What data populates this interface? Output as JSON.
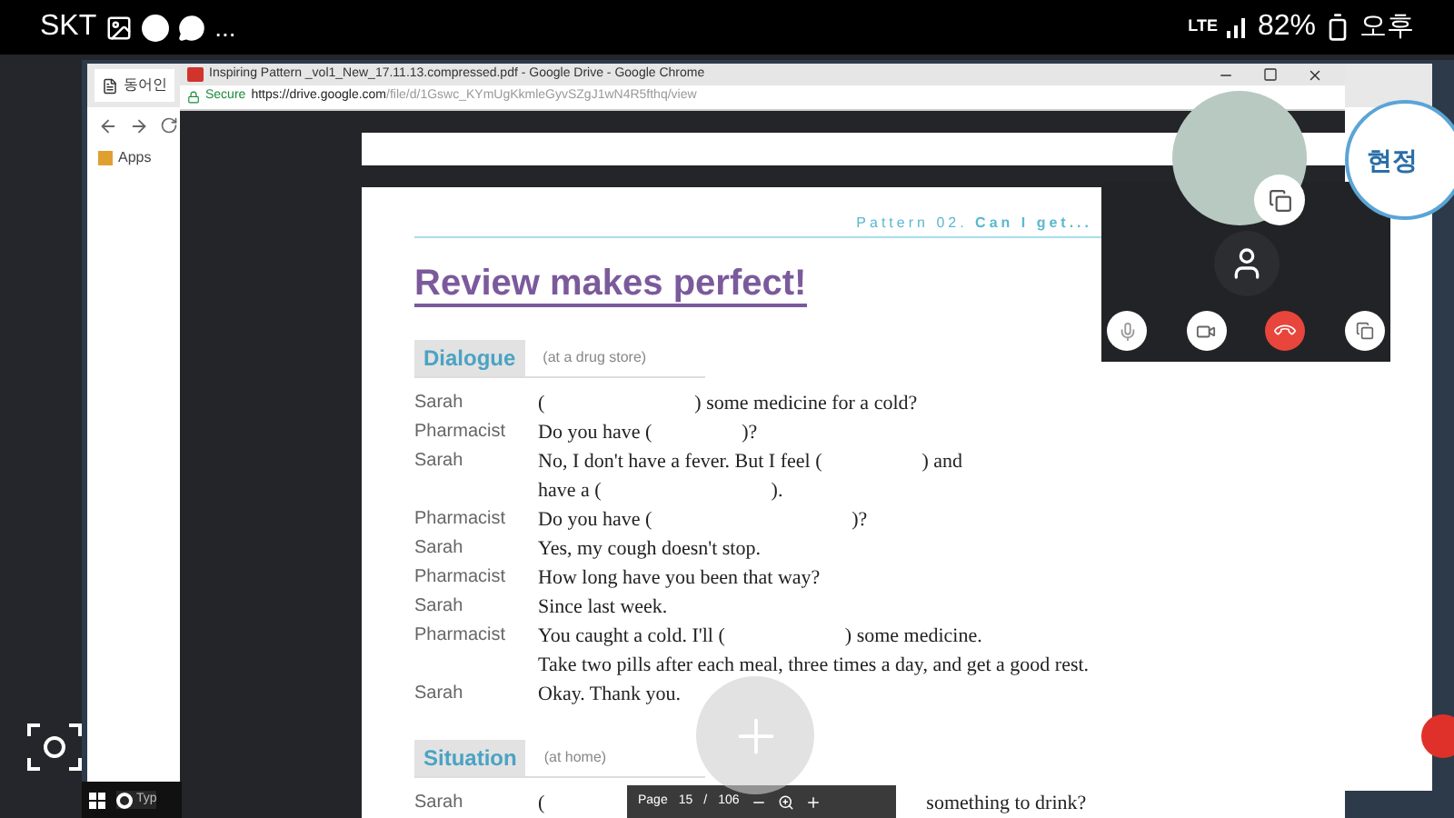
{
  "status_bar": {
    "carrier": "SKT",
    "more": "...",
    "network": "LTE",
    "battery": "82%",
    "time": "오후"
  },
  "back_window": {
    "tab": "동어인",
    "bookmark": "Apps"
  },
  "window": {
    "title": "Inspiring Pattern _vol1_New_17.11.13.compressed.pdf - Google Drive - Google Chrome",
    "secure": "Secure",
    "url_host": "https://drive.google.com",
    "url_path": "/file/d/1Gswc_KYmUgKkmleGyvSZgJ1wN4R5fthq/view"
  },
  "document": {
    "header": "Pattern 02.",
    "header_bold": "Can I get...",
    "title": "Review makes perfect!",
    "sections": [
      {
        "heading": "Dialogue",
        "note": "(at a drug store)",
        "lines": [
          {
            "speaker": "Sarah",
            "text": "(                              ) some medicine for a cold?"
          },
          {
            "speaker": "Pharmacist",
            "text": "Do you have (                  )?"
          },
          {
            "speaker": "Sarah",
            "text": "No, I don't have a fever. But I feel (                    ) and"
          },
          {
            "text": "have a (                                  )."
          },
          {
            "speaker": "Pharmacist",
            "text": "Do you have (                                        )?"
          },
          {
            "speaker": "Sarah",
            "text": "Yes, my cough doesn't stop."
          },
          {
            "speaker": "Pharmacist",
            "text": "How long have you been that way?"
          },
          {
            "speaker": "Sarah",
            "text": "Since last week."
          },
          {
            "speaker": "Pharmacist",
            "text": "You caught a cold. I'll (                        ) some medicine."
          },
          {
            "text": "Take two pills after each meal, three times a day, and get a good rest."
          },
          {
            "speaker": "Sarah",
            "text": "Okay. Thank you."
          }
        ]
      },
      {
        "heading": "Situation",
        "note": "(at home)",
        "lines": [
          {
            "speaker": "Sarah",
            "text": "(",
            "tail": "something to drink?"
          }
        ]
      }
    ]
  },
  "pdf_toolbar": {
    "page_label": "Page",
    "page": "15",
    "separator": "/",
    "total": "106"
  },
  "call": {
    "contact": "현정",
    "muted": false
  },
  "taskbar": {
    "search": "Typ"
  }
}
